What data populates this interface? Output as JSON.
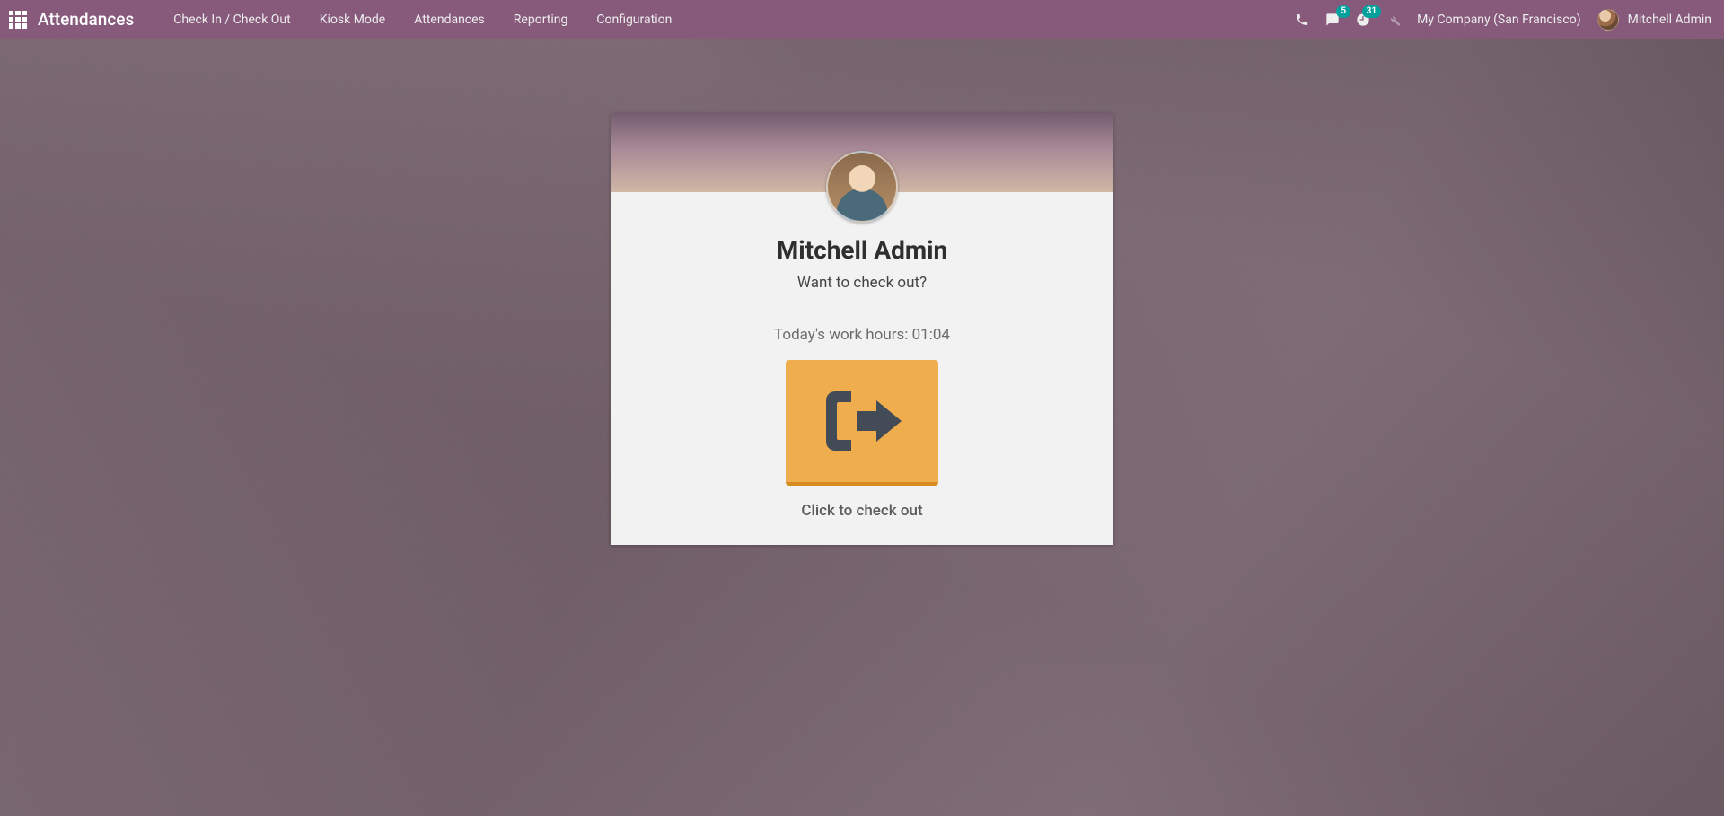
{
  "nav": {
    "app_title": "Attendances",
    "menu": [
      "Check In / Check Out",
      "Kiosk Mode",
      "Attendances",
      "Reporting",
      "Configuration"
    ],
    "messages_badge": "5",
    "activities_badge": "31",
    "company": "My Company (San Francisco)",
    "user": "Mitchell Admin"
  },
  "card": {
    "employee_name": "Mitchell Admin",
    "prompt": "Want to check out?",
    "hours_label": "Today's work hours: ",
    "hours_value": "01:04",
    "click_text": "Click to check out"
  }
}
